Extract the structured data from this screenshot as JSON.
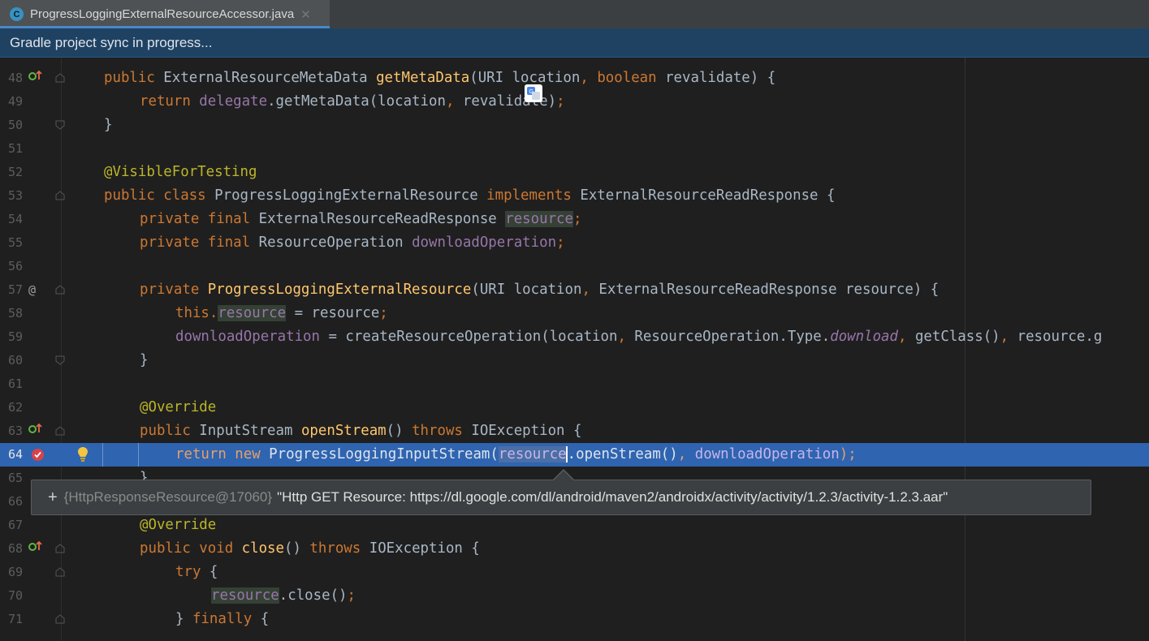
{
  "tab": {
    "icon_letter": "C",
    "title": "ProgressLoggingExternalResourceAccessor.java",
    "close_icon": "close-icon"
  },
  "notification": {
    "text": "Gradle project sync in progress..."
  },
  "editor": {
    "line_numbers": [
      "48",
      "49",
      "50",
      "51",
      "52",
      "53",
      "54",
      "55",
      "56",
      "57",
      "58",
      "59",
      "60",
      "61",
      "62",
      "63",
      "64",
      "65",
      "66",
      "67",
      "68",
      "69",
      "70",
      "71"
    ],
    "current_line": "64",
    "lines": {
      "l48": {
        "a": "public ",
        "b": "ExternalResourceMetaData ",
        "c": "getMetaData",
        "d": "(URI location",
        "e": ", ",
        "f": "boolean ",
        "g": "revalidate) {"
      },
      "l49": {
        "a": "return ",
        "b": "delegate",
        ".c": "",
        "c": ".getMetaData(location",
        "d": ", ",
        "e": "revalidate)",
        "f": ";"
      },
      "l50": {
        "a": "}"
      },
      "l52": {
        "a": "@VisibleForTesting"
      },
      "l53": {
        "a": "public class ",
        "b": "ProgressLoggingExternalResource ",
        "c": "implements ",
        "d": "ExternalResourceReadResponse {"
      },
      "l54": {
        "a": "private final ",
        "b": "ExternalResourceReadResponse ",
        "c": "resource",
        "d": ";"
      },
      "l55": {
        "a": "private final ",
        "b": "ResourceOperation ",
        "c": "downloadOperation",
        "d": ";"
      },
      "l57": {
        "a": "private ",
        "b": "ProgressLoggingExternalResource",
        "c": "(URI location",
        "d": ", ",
        "e": "ExternalResourceReadResponse resource) {"
      },
      "l58": {
        "a": "this.",
        "b": "resource",
        "c": " = resource",
        "d": ";"
      },
      "l59": {
        "a": "downloadOperation",
        "b": " = createResourceOperation(location",
        "c": ", ",
        "d": "ResourceOperation.Type.",
        "e": "download",
        "f": ", ",
        "g": "getClass()",
        "h": ", ",
        "i": "resource.g"
      },
      "l60": {
        "a": "}"
      },
      "l62": {
        "a": "@Override"
      },
      "l63": {
        "a": "public ",
        "b": "InputStream ",
        "c": "openStream",
        "d": "() ",
        "e": "throws ",
        "f": "IOException {"
      },
      "l64": {
        "a": "return new ",
        "b": "ProgressLoggingInputStream(",
        "c": "resource",
        "d": ".openStream()",
        "e": ", ",
        "f": "downloadOperation",
        "g": ");"
      },
      "l65": {
        "a": "}"
      },
      "l67": {
        "a": "@Override"
      },
      "l68": {
        "a": "public void ",
        "b": "close",
        "c": "() ",
        "d": "throws ",
        "e": "IOException {"
      },
      "l69": {
        "a": "try ",
        "b": "{"
      },
      "l70": {
        "a": "resource",
        "b": ".close()",
        "c": ";"
      },
      "l71": {
        "a": "} ",
        "b": "finally ",
        "c": "{"
      }
    }
  },
  "tooltip": {
    "expand": "+",
    "ref": "{HttpResponseResource@17060}",
    "value": "\"Http GET Resource: https://dl.google.com/dl/android/maven2/androidx/activity/activity/1.2.3/activity-1.2.3.aar\""
  },
  "gutter_icons": {
    "override": "override-up-icon",
    "at": "@",
    "breakpoint": "breakpoint-icon",
    "bulb": "lightbulb-icon"
  },
  "colors": {
    "keyword": "#cc7832",
    "function": "#ffc66d",
    "field": "#9876aa",
    "annotation": "#bbb529",
    "execution_line": "#2f64b0",
    "notification_bg": "#1f4263"
  }
}
